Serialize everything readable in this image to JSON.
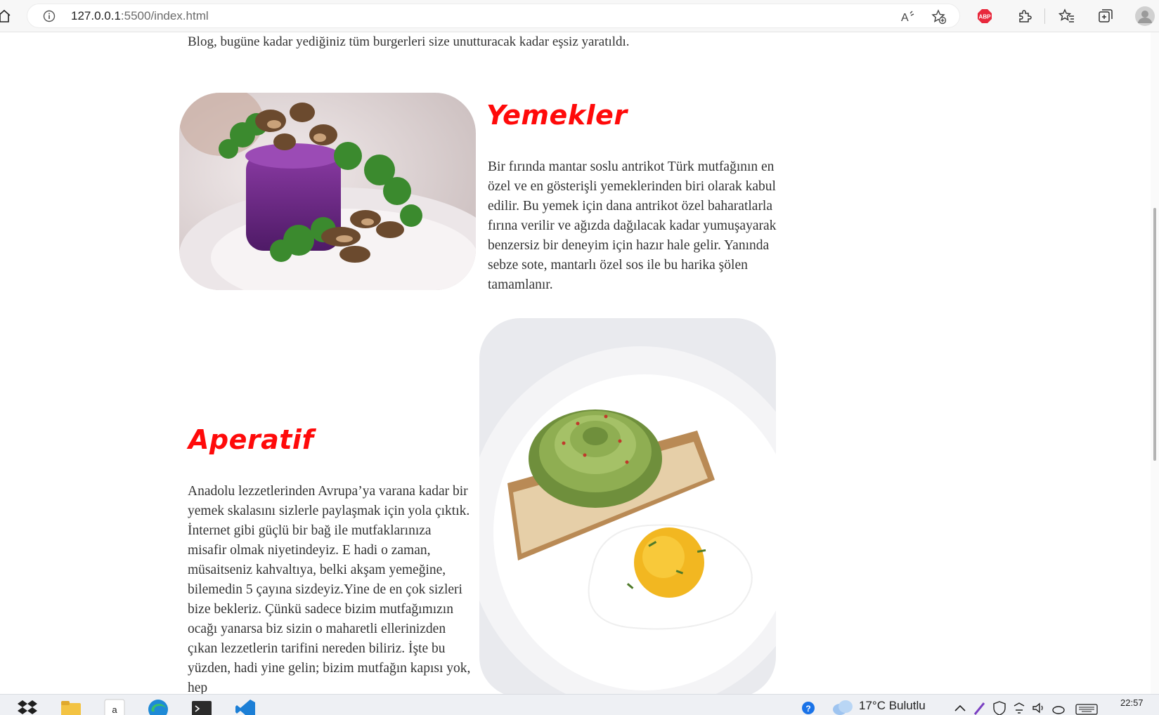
{
  "browser": {
    "url_host": "127.0.0.1",
    "url_path": ":5500/index.html",
    "icons": [
      "home-icon",
      "info-icon",
      "read-aloud-icon",
      "add-favorite-icon",
      "adblock-icon",
      "extensions-icon",
      "favorites-icon",
      "collections-icon",
      "profile-icon"
    ],
    "abp_label": "ABP"
  },
  "page": {
    "intro_text": "Blog, bugüne kadar yediğiniz tüm burgerleri size unutturacak kadar eşsiz yaratıldı.",
    "sections": [
      {
        "heading": "Yemekler",
        "text": "Bir fırında mantar soslu antrikot Türk mutfağının en özel ve en gösterişli yemeklerinden biri olarak kabul edilir. Bu yemek için dana antrikot özel baharatlarla fırına verilir ve ağızda dağılacak kadar yumuşayarak benzersiz bir deneyim için hazır hale gelir. Yanında sebze sote, mantarlı özel sos ile bu harika şölen tamamlanır."
      },
      {
        "heading": "Aperatif",
        "text": "Anadolu lezzetlerinden Avrupa’ya varana kadar bir yemek skalasını sizlerle paylaşmak için yola çıktık. İnternet gibi güçlü bir bağ ile mutfaklarınıza misafir olmak niyetindeyiz. E hadi o zaman, müsaitseniz kahvaltıya, belki akşam yemeğine, bilemedin 5 çayına sizdeyiz.Yine de en çok sizleri bize bekleriz. Çünkü sadece bizim mutfağımızın ocağı yanarsa biz sizin o maharetli ellerinizden çıkan lezzetlerin tarifini nereden biliriz. İşte bu yüzden, hadi yine gelin; bizim mutfağın kapısı yok, hep"
      }
    ]
  },
  "taskbar": {
    "weather": "17°C  Bulutlu",
    "time": "22:57",
    "apps": [
      "dropbox-icon",
      "file-explorer-icon",
      "amazon-icon",
      "edge-icon",
      "terminal-icon",
      "vscode-icon"
    ]
  },
  "colors": {
    "heading": "#ff0a0a",
    "text": "#333333",
    "chrome": "#f7f7f7",
    "taskbar": "#eef0f4"
  }
}
